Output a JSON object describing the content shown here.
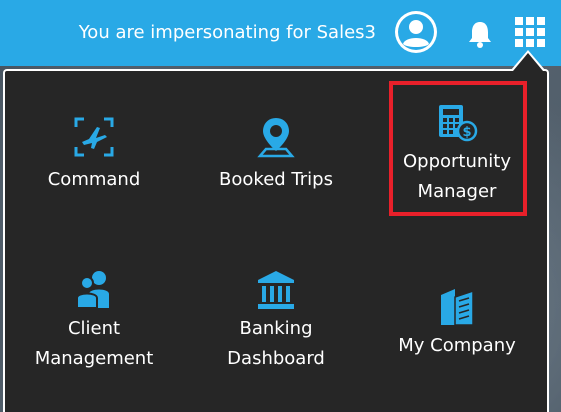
{
  "header": {
    "impersonating_text": "You are impersonating for Sales3",
    "avatar_icon": "user-avatar-icon",
    "notifications_icon": "bell-icon",
    "apps_icon": "app-grid-icon",
    "bar_color": "#29a9e6"
  },
  "apps_menu": {
    "background": "#262626",
    "icon_color": "#29a9e6",
    "highlight_color": "#e8202a",
    "tiles": [
      {
        "line1": "Command",
        "line2": "",
        "icon": "plane-target-icon"
      },
      {
        "line1": "Booked Trips",
        "line2": "",
        "icon": "location-pin-icon"
      },
      {
        "line1": "Opportunity",
        "line2": "Manager",
        "icon": "calculator-dollar-icon"
      },
      {
        "line1": "Client",
        "line2": "Management",
        "icon": "users-icon"
      },
      {
        "line1": "Banking",
        "line2": "Dashboard",
        "icon": "bank-icon"
      },
      {
        "line1": "My Company",
        "line2": "",
        "icon": "buildings-icon"
      }
    ]
  }
}
